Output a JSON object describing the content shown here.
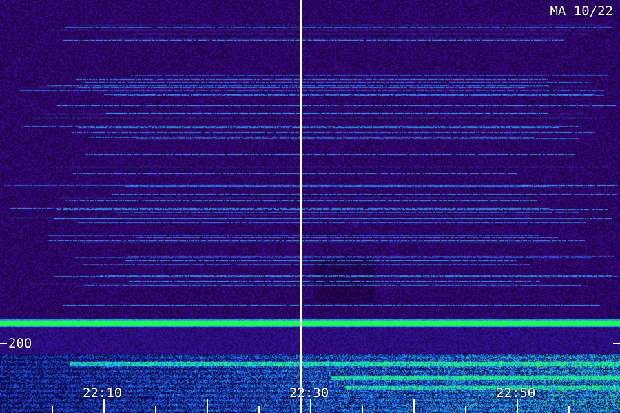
{
  "station_label": "MA 10/22",
  "frequency_label": "200",
  "time_labels": [
    "22:10",
    "22:30",
    "22:50"
  ],
  "colors": {
    "background_deep": "#1a0a3a",
    "noise_purple": "#3a1a9a",
    "line_blue": "#2a5aff",
    "signal_green": "#1aff6a",
    "signal_cyan": "#1aaeff",
    "divider": "#ffffff",
    "text": "#ffffff"
  }
}
